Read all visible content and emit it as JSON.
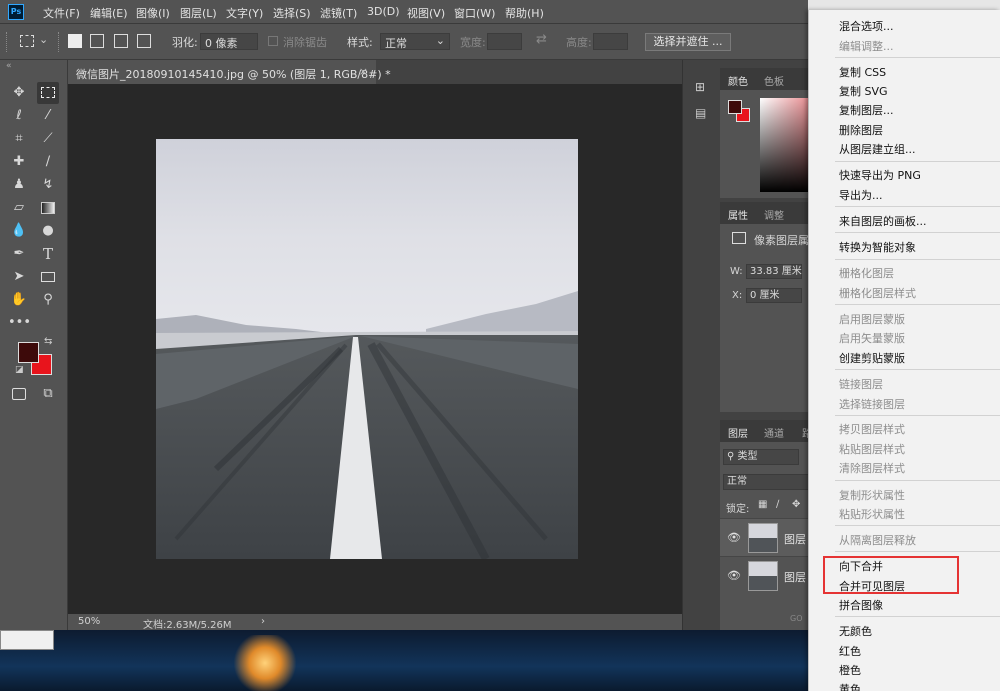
{
  "menubar": {
    "logo": "Ps",
    "items": [
      "文件(F)",
      "编辑(E)",
      "图像(I)",
      "图层(L)",
      "文字(Y)",
      "选择(S)",
      "滤镜(T)",
      "3D(D)",
      "视图(V)",
      "窗口(W)",
      "帮助(H)"
    ]
  },
  "options": {
    "feather_label": "羽化:",
    "feather_value": "0 像素",
    "antialias_label": "消除锯齿",
    "style_label": "样式:",
    "style_value": "正常",
    "width_label": "宽度:",
    "height_label": "高度:",
    "select_mask_label": "选择并遮住 ..."
  },
  "document": {
    "tab_title": "微信图片_20180910145410.jpg @ 50% (图层 1, RGB/8#) *",
    "close_glyph": "×",
    "zoom": "50%",
    "doc_info": "文档:2.63M/5.26M",
    "status_arrow": "›"
  },
  "panels": {
    "color_tabs": [
      "颜色",
      "色板"
    ],
    "properties_tabs": [
      "属性",
      "调整"
    ],
    "properties_type": "像素图层属",
    "w_label": "W:",
    "w_value": "33.83 厘米",
    "x_label": "X:",
    "x_value": "0 厘米",
    "layers_tabs": [
      "图层",
      "通道",
      "路"
    ],
    "filter_kind": "类型",
    "blend_mode": "正常",
    "lock_label": "锁定:",
    "layers": [
      {
        "name": "图层"
      },
      {
        "name": "图层"
      }
    ],
    "footer_glyph": "GO"
  },
  "context_menu": {
    "items": [
      {
        "label": "混合选项...",
        "enabled": true
      },
      {
        "label": "编辑调整...",
        "enabled": false
      },
      {
        "label": "复制 CSS",
        "enabled": true
      },
      {
        "label": "复制 SVG",
        "enabled": true
      },
      {
        "label": "复制图层...",
        "enabled": true
      },
      {
        "label": "删除图层",
        "enabled": true
      },
      {
        "label": "从图层建立组...",
        "enabled": true
      },
      {
        "label": "快速导出为 PNG",
        "enabled": true
      },
      {
        "label": "导出为...",
        "enabled": true
      },
      {
        "label": "来自图层的画板...",
        "enabled": true
      },
      {
        "label": "转换为智能对象",
        "enabled": true
      },
      {
        "label": "栅格化图层",
        "enabled": false
      },
      {
        "label": "栅格化图层样式",
        "enabled": false
      },
      {
        "label": "启用图层蒙版",
        "enabled": false
      },
      {
        "label": "启用矢量蒙版",
        "enabled": false
      },
      {
        "label": "创建剪贴蒙版",
        "enabled": true
      },
      {
        "label": "链接图层",
        "enabled": false
      },
      {
        "label": "选择链接图层",
        "enabled": false
      },
      {
        "label": "拷贝图层样式",
        "enabled": false
      },
      {
        "label": "粘贴图层样式",
        "enabled": false
      },
      {
        "label": "清除图层样式",
        "enabled": false
      },
      {
        "label": "复制形状属性",
        "enabled": false
      },
      {
        "label": "粘贴形状属性",
        "enabled": false
      },
      {
        "label": "从隔离图层释放",
        "enabled": false
      },
      {
        "label": "向下合并",
        "enabled": true
      },
      {
        "label": "合并可见图层",
        "enabled": true
      },
      {
        "label": "拼合图像",
        "enabled": true
      },
      {
        "label": "无颜色",
        "enabled": true
      },
      {
        "label": "红色",
        "enabled": true
      },
      {
        "label": "橙色",
        "enabled": true
      },
      {
        "label": "黄色",
        "enabled": true
      }
    ]
  },
  "colors": {
    "foreground": "#3d0a0a",
    "background": "#e8141c",
    "highlight": "#e53333"
  },
  "icons": [
    "move-icon",
    "marquee-icon",
    "lasso-icon",
    "magic-wand-icon",
    "crop-icon",
    "eyedropper-icon",
    "healing-brush-icon",
    "brush-icon",
    "clone-stamp-icon",
    "history-brush-icon",
    "eraser-icon",
    "gradient-icon",
    "blur-icon",
    "dodge-icon",
    "pen-icon",
    "type-icon",
    "path-select-icon",
    "rectangle-icon",
    "hand-icon",
    "zoom-icon",
    "more-tools-icon"
  ]
}
